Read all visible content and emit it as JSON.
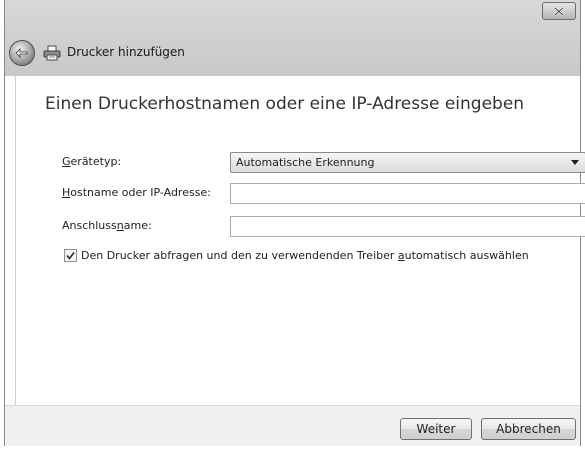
{
  "window": {
    "title": "Drucker hinzufügen",
    "close_label": "Schließen"
  },
  "page": {
    "heading": "Einen Druckerhostnamen oder eine IP-Adresse eingeben"
  },
  "form": {
    "device_type": {
      "label_accel": "G",
      "label_rest": "erätetyp:",
      "value": "Automatische Erkennung"
    },
    "hostname": {
      "label_accel": "H",
      "label_rest": "ostname oder IP-Adresse:",
      "value": ""
    },
    "port_name": {
      "label_pre": "Anschluss",
      "label_accel": "n",
      "label_rest": "ame:",
      "value": ""
    },
    "query_printer": {
      "checked": true,
      "label_pre": "Den Drucker abfragen und den zu verwendenden Treiber ",
      "label_accel": "a",
      "label_rest": "utomatisch auswählen"
    }
  },
  "footer": {
    "next_label": "Weiter",
    "cancel_label": "Abbrechen"
  },
  "icons": {
    "back": "back-arrow-icon",
    "printer": "printer-icon",
    "close": "close-icon",
    "dropdown": "chevron-down-icon",
    "checkmark": "checkmark-icon"
  }
}
